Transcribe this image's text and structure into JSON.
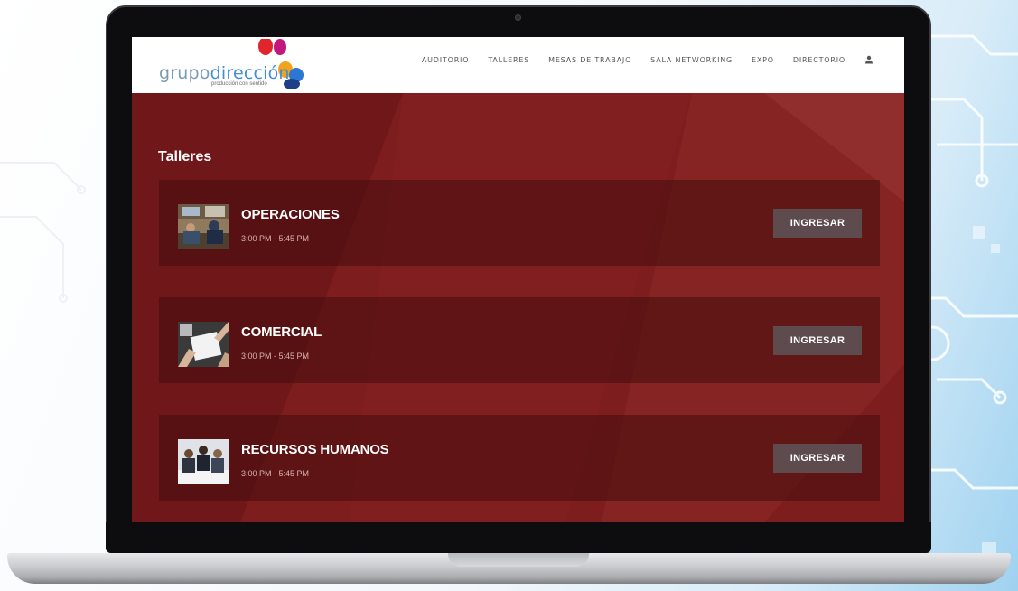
{
  "nav": {
    "logo": {
      "brand_part1": "grupo",
      "brand_part2": "dirección",
      "tagline": "producción con sentido"
    },
    "items": [
      {
        "label": "AUDITORIO"
      },
      {
        "label": "TALLERES"
      },
      {
        "label": "MESAS DE TRABAJO"
      },
      {
        "label": "SALA NETWORKING"
      },
      {
        "label": "EXPO"
      },
      {
        "label": "DIRECTORIO"
      }
    ],
    "user_icon": "user-icon"
  },
  "page": {
    "title": "Talleres"
  },
  "workshops": [
    {
      "title": "OPERACIONES",
      "time": "3:00 PM - 5:45 PM",
      "button": "INGRESAR",
      "thumb_icon": "meeting-photo"
    },
    {
      "title": "COMERCIAL",
      "time": "3:00 PM - 5:45 PM",
      "button": "INGRESAR",
      "thumb_icon": "documents-photo"
    },
    {
      "title": "RECURSOS HUMANOS",
      "time": "3:00 PM - 5:45 PM",
      "button": "INGRESAR",
      "thumb_icon": "team-photo"
    }
  ],
  "colors": {
    "background": "#7a1c1c",
    "card": "#5a1616",
    "button": "#5e4b4d",
    "logo_accent": "#3f8ed8"
  }
}
